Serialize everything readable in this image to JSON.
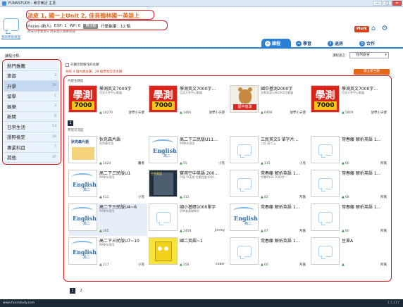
{
  "window": {
    "title": "FUNNSTUDY - 單字筆記 主頁",
    "minimize": "—",
    "maximize": "□",
    "close": "✕"
  },
  "header": {
    "promo": "派皮 1, 國一上Unit 2, 佳音翰林國一英語上",
    "user": "Pisces (新人)",
    "exp": "EXP: 1",
    "wp": "WP: 0",
    "badge": "無活動",
    "stats": "行動能量：12 點",
    "breadcrumb": "尚未分享資源 ▸ 尚未加入親師訊錄",
    "logo_caption": "我的學習頁面",
    "plurk": "Plurk"
  },
  "tabs": [
    {
      "label": "課程",
      "icon": "link-icon"
    },
    {
      "label": "學習",
      "icon": "arrow-icon"
    },
    {
      "label": "退房",
      "icon": "info-icon"
    },
    {
      "label": "合作",
      "icon": "group-icon"
    }
  ],
  "sidebar": {
    "title": "課程分類：",
    "items": [
      {
        "label": "熱門推薦",
        "count": ""
      },
      {
        "label": "旅遊",
        "count": "3"
      },
      {
        "label": "升學",
        "count": "26"
      },
      {
        "label": "留學",
        "count": "1"
      },
      {
        "label": "娛樂",
        "count": "2"
      },
      {
        "label": "新聞",
        "count": "0"
      },
      {
        "label": "日常生活",
        "count": "13"
      },
      {
        "label": "證照檢定",
        "count": "16"
      },
      {
        "label": "專業科目",
        "count": "7"
      },
      {
        "label": "其他",
        "count": "47"
      }
    ]
  },
  "main": {
    "checkbox": "只顯示我製作的主題",
    "lang_label": "課程語言：",
    "lang_value": "任何語言",
    "summary": "共有 4 個內建主題，29 個學習交流主題",
    "new_button": "建立新主題",
    "builtin_label": "內建主題區",
    "exchange_label": "學習交流區",
    "builtin_page": "1",
    "builtin": [
      {
        "title": "學測英文7000字",
        "sub": "包含大考中心範圍",
        "likes": "10270",
        "author": "放學小天使",
        "thumb": "red",
        "big": "學測",
        "small": "7000"
      },
      {
        "title": "學測英文7000字…",
        "sub": "包含大考中心範圍",
        "likes": "3466",
        "author": "放學小天使",
        "thumb": "red",
        "big": "學測",
        "small": "7000"
      },
      {
        "title": "國中基測2000字",
        "sub": "含教育部公佈2000字範圍",
        "likes": "6408",
        "author": "放學小天使",
        "thumb": "bear",
        "big": "國中基測",
        "small": ""
      },
      {
        "title": "學測英文7000字…",
        "sub": "包含大考中心範圍",
        "likes": "5809",
        "author": "放學小天使",
        "thumb": "red",
        "big": "學測",
        "small": "7000"
      }
    ],
    "exchange": [
      {
        "title": "狄克森片語",
        "sub": "狄克森片語",
        "likes": "1424",
        "author": "醫者",
        "thumb": "word",
        "extra": "狄克森片語"
      },
      {
        "title": "高二下三民版U11…",
        "sub": "99學年適用",
        "likes": "55",
        "author": "小克",
        "thumb": "english"
      },
      {
        "title": "三民英文5 單字片…",
        "sub": "三民 高二上",
        "likes": "115",
        "author": "小克",
        "thumb": "placeholder"
      },
      {
        "title": "常春藤 解析英語 1…",
        "sub": "",
        "likes": "66",
        "author": "阿嘉",
        "thumb": "placeholder"
      },
      {
        "title": "高二下三民版U1",
        "sub": "99學年適用",
        "likes": "411",
        "author": "小克",
        "thumb": "english"
      },
      {
        "title": "實用空中英語 200…",
        "sub": "中級 中英語 字彙程度4000…",
        "likes": "315",
        "author": "",
        "thumb": "movie",
        "extra": "空中英語"
      },
      {
        "title": "常春藤 解析英語 1…",
        "sub": "字彙4500-7000字",
        "likes": "83",
        "author": "阿嘉",
        "thumb": "placeholder"
      },
      {
        "title": "常春藤 解析英語 1…",
        "sub": "",
        "likes": "68",
        "author": "阿嘉",
        "thumb": "placeholder"
      },
      {
        "title": "高二下三民版U4~6",
        "sub": "99學年適用",
        "likes": "165",
        "author": "",
        "thumb": "english"
      },
      {
        "title": "國小基礎1000單字",
        "sub": "初學者基礎單字",
        "likes": "2408",
        "author": "Jimmy",
        "thumb": "placeholder"
      },
      {
        "title": "常春藤 解析英語 1…",
        "sub": "",
        "likes": "87",
        "author": "阿嘉",
        "thumb": "english"
      },
      {
        "title": "常春藤 解析英語 1…",
        "sub": "",
        "likes": "80",
        "author": "阿嘉",
        "thumb": "placeholder"
      },
      {
        "title": "高二下三民版U7~10",
        "sub": "99學年適用",
        "likes": "217",
        "author": "小克",
        "thumb": "english"
      },
      {
        "title": "國二英語~1",
        "sub": "",
        "likes": "356",
        "author": "cober",
        "thumb": "sponge"
      },
      {
        "title": "常春藤 解析英語 1…",
        "sub": "",
        "likes": "60",
        "author": "阿嘉",
        "thumb": "placeholder"
      },
      {
        "title": "豆單A",
        "sub": "",
        "likes": "",
        "author": "阿嘉",
        "thumb": "placeholder"
      }
    ],
    "pages": [
      "1",
      "2"
    ]
  },
  "footer": {
    "site": "www.funnstudy.com",
    "version": "1.5.117"
  },
  "colors": {
    "accent": "#2b7fd4",
    "highlight": "#d8181e",
    "promo": "#e0661c"
  }
}
